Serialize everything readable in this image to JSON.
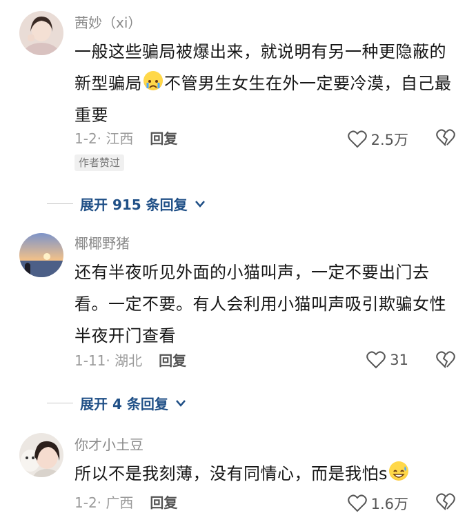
{
  "comments": [
    {
      "username": "茜妙（xi）",
      "text_parts": [
        "一般这些骗局被爆出来，就说明有另一种更隐蔽的新型骗局",
        "不管男生女生在外一定要冷漠，自己最重要"
      ],
      "emoji": "crying-face",
      "meta": "1-2· 江西",
      "reply_label": "回复",
      "likes": "2.5万",
      "badge": "作者赞过",
      "expand_label": "展开 915 条回复"
    },
    {
      "username": "椰椰野猪",
      "text": "还有半夜听见外面的小猫叫声，一定不要出门去看。一定不要。有人会利用小猫叫声吸引欺骗女性半夜开门查看",
      "meta": "1-11· 湖北",
      "reply_label": "回复",
      "likes": "31",
      "expand_label": "展开 4 条回复"
    },
    {
      "username": "你才小土豆",
      "text": "所以不是我刻薄，没有同情心，而是我怕s",
      "emoji": "grinning-sweat-face",
      "meta": "1-2· 广西",
      "reply_label": "回复",
      "likes": "1.6万"
    }
  ],
  "colors": {
    "username": "#8a8a8a",
    "link": "#1f4f86",
    "meta": "#9a9a9a"
  }
}
